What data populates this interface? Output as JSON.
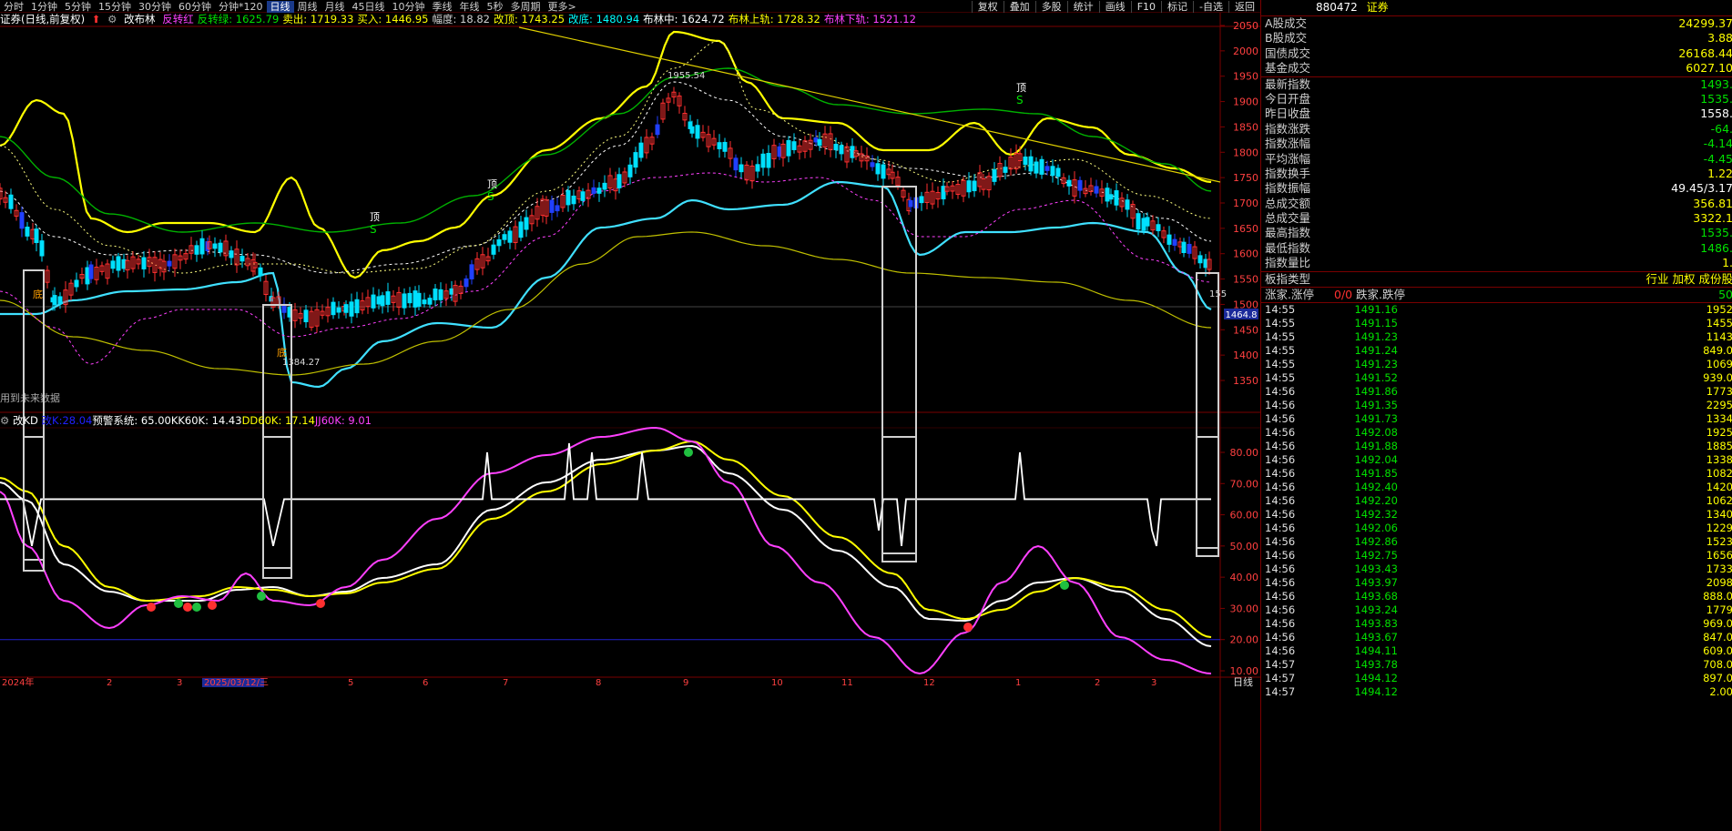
{
  "toolbar": {
    "periods": [
      "分时",
      "1分钟",
      "5分钟",
      "15分钟",
      "30分钟",
      "60分钟",
      "分钟*120",
      "日线",
      "周线",
      "月线",
      "45日线",
      "10分钟",
      "季线",
      "年线",
      "5秒",
      "多周期",
      "更多>"
    ],
    "active_period": "日线",
    "right_buttons": [
      "复权",
      "叠加",
      "多股",
      "统计",
      "画线",
      "F10",
      "标记",
      "-自选",
      "返回"
    ]
  },
  "main_indicator": {
    "title": "证券(日线,前复权)",
    "name": "改布林",
    "items": [
      {
        "label": "反转红",
        "color": "#ff40ff"
      },
      {
        "label": "反转绿: 1625.79",
        "color": "#00e000"
      },
      {
        "label": "卖出: 1719.33",
        "color": "#ffff00"
      },
      {
        "label": "买入: 1446.95",
        "color": "#ffff00"
      },
      {
        "label": "幅度: 18.82",
        "color": "#d0d0d0"
      },
      {
        "label": "改顶: 1743.25",
        "color": "#ffff00"
      },
      {
        "label": "改底: 1480.94",
        "color": "#00ffff"
      },
      {
        "label": "布林中: 1624.72",
        "color": "#ffffff"
      },
      {
        "label": "布林上轨: 1728.32",
        "color": "#ffff00"
      },
      {
        "label": "布林下轨: 1521.12",
        "color": "#ff40ff"
      }
    ],
    "annotations": {
      "high": "1955.54",
      "low": "1384.27",
      "last": "155",
      "top_mark": "顶",
      "bottom_mark": "底",
      "future_note": "用到未来数据"
    },
    "price_ticks": [
      "2050",
      "2000",
      "1950",
      "1900",
      "1850",
      "1800",
      "1750",
      "1700",
      "1650",
      "1600",
      "1550",
      "1500",
      "1450",
      "1400",
      "1350"
    ],
    "current_price_tag": "1464.8"
  },
  "sub_indicator": {
    "name": "改KD",
    "items": [
      {
        "label": "改K:",
        "color": "#2020ff"
      },
      {
        "label": "28.04",
        "color": "#2020ff"
      },
      {
        "label": "预警系统: 65.00",
        "color": "#ffffff"
      },
      {
        "label": "KK60K: 14.43",
        "color": "#ffffff"
      },
      {
        "label": "DD60K: 17.14",
        "color": "#ffff00"
      },
      {
        "label": "JJ60K: 9.01",
        "color": "#ff40ff"
      }
    ],
    "ticks": [
      "80.00",
      "70.00",
      "60.00",
      "50.00",
      "40.00",
      "30.00",
      "20.00",
      "10.00"
    ]
  },
  "xaxis": {
    "labels": [
      "2024年",
      "2",
      "3",
      "2025/03/12/三",
      "5",
      "6",
      "7",
      "8",
      "9",
      "10",
      "11",
      "12",
      "1",
      "2",
      "3"
    ],
    "period_label": "日线"
  },
  "right_panel": {
    "code": "880472",
    "name": "证券",
    "rows": [
      {
        "k": "A股成交",
        "v": "24299.37",
        "c": "#ffff00"
      },
      {
        "k": "B股成交",
        "v": "3.88",
        "c": "#ffff00"
      },
      {
        "k": "国债成交",
        "v": "26168.44",
        "c": "#ffff00"
      },
      {
        "k": "基金成交",
        "v": "6027.10",
        "c": "#ffff00"
      },
      {
        "k": "最新指数",
        "v": "1493.",
        "c": "#00e000"
      },
      {
        "k": "今日开盘",
        "v": "1535.",
        "c": "#00e000"
      },
      {
        "k": "昨日收盘",
        "v": "1558.",
        "c": "#ffffff"
      },
      {
        "k": "指数涨跌",
        "v": "-64.",
        "c": "#00e000"
      },
      {
        "k": "指数涨幅",
        "v": "-4.14",
        "c": "#00e000"
      },
      {
        "k": "平均涨幅",
        "v": "-4.45",
        "c": "#00e000"
      },
      {
        "k": "指数换手",
        "v": "1.22",
        "c": "#ffff00"
      },
      {
        "k": "指数振幅",
        "v": "49.45/3.17",
        "c": "#ffffff"
      },
      {
        "k": "总成交额",
        "v": "356.81",
        "c": "#ffff00"
      },
      {
        "k": "总成交量",
        "v": "3322.1",
        "c": "#ffff00"
      },
      {
        "k": "最高指数",
        "v": "1535.",
        "c": "#00e000"
      },
      {
        "k": "最低指数",
        "v": "1486.",
        "c": "#00e000"
      },
      {
        "k": "指数量比",
        "v": "1.",
        "c": "#ffff00"
      }
    ],
    "board_type": {
      "k": "板指类型",
      "v": "行业 加权 成份股"
    },
    "updown": {
      "k": "涨家.涨停",
      "mid": "0/0",
      "k2": "跌家.跌停",
      "v": "50"
    },
    "ticks": [
      {
        "t": "14:55",
        "p": "1491.16",
        "q": "1952"
      },
      {
        "t": "14:55",
        "p": "1491.15",
        "q": "1455"
      },
      {
        "t": "14:55",
        "p": "1491.23",
        "q": "1143"
      },
      {
        "t": "14:55",
        "p": "1491.24",
        "q": "849.0"
      },
      {
        "t": "14:55",
        "p": "1491.23",
        "q": "1069"
      },
      {
        "t": "14:55",
        "p": "1491.52",
        "q": "939.0"
      },
      {
        "t": "14:56",
        "p": "1491.86",
        "q": "1773"
      },
      {
        "t": "14:56",
        "p": "1491.35",
        "q": "2295"
      },
      {
        "t": "14:56",
        "p": "1491.73",
        "q": "1334"
      },
      {
        "t": "14:56",
        "p": "1492.08",
        "q": "1925"
      },
      {
        "t": "14:56",
        "p": "1491.88",
        "q": "1885"
      },
      {
        "t": "14:56",
        "p": "1492.04",
        "q": "1338"
      },
      {
        "t": "14:56",
        "p": "1491.85",
        "q": "1082"
      },
      {
        "t": "14:56",
        "p": "1492.40",
        "q": "1420"
      },
      {
        "t": "14:56",
        "p": "1492.20",
        "q": "1062"
      },
      {
        "t": "14:56",
        "p": "1492.32",
        "q": "1340"
      },
      {
        "t": "14:56",
        "p": "1492.06",
        "q": "1229"
      },
      {
        "t": "14:56",
        "p": "1492.86",
        "q": "1523"
      },
      {
        "t": "14:56",
        "p": "1492.75",
        "q": "1656"
      },
      {
        "t": "14:56",
        "p": "1493.43",
        "q": "1733"
      },
      {
        "t": "14:56",
        "p": "1493.97",
        "q": "2098"
      },
      {
        "t": "14:56",
        "p": "1493.68",
        "q": "888.0"
      },
      {
        "t": "14:56",
        "p": "1493.24",
        "q": "1779"
      },
      {
        "t": "14:56",
        "p": "1493.83",
        "q": "969.0"
      },
      {
        "t": "14:56",
        "p": "1493.67",
        "q": "847.0"
      },
      {
        "t": "14:56",
        "p": "1494.11",
        "q": "609.0"
      },
      {
        "t": "14:57",
        "p": "1493.78",
        "q": "708.0"
      },
      {
        "t": "14:57",
        "p": "1494.12",
        "q": "897.0"
      },
      {
        "t": "14:57",
        "p": "1494.12",
        "q": "2.00"
      }
    ]
  },
  "colors": {
    "up": "#ff3030",
    "down": "#00e0ff",
    "yellow": "#ffff00",
    "magenta": "#ff40ff",
    "green": "#00c000",
    "cyan": "#40e0ff",
    "grid": "#7a0000"
  }
}
